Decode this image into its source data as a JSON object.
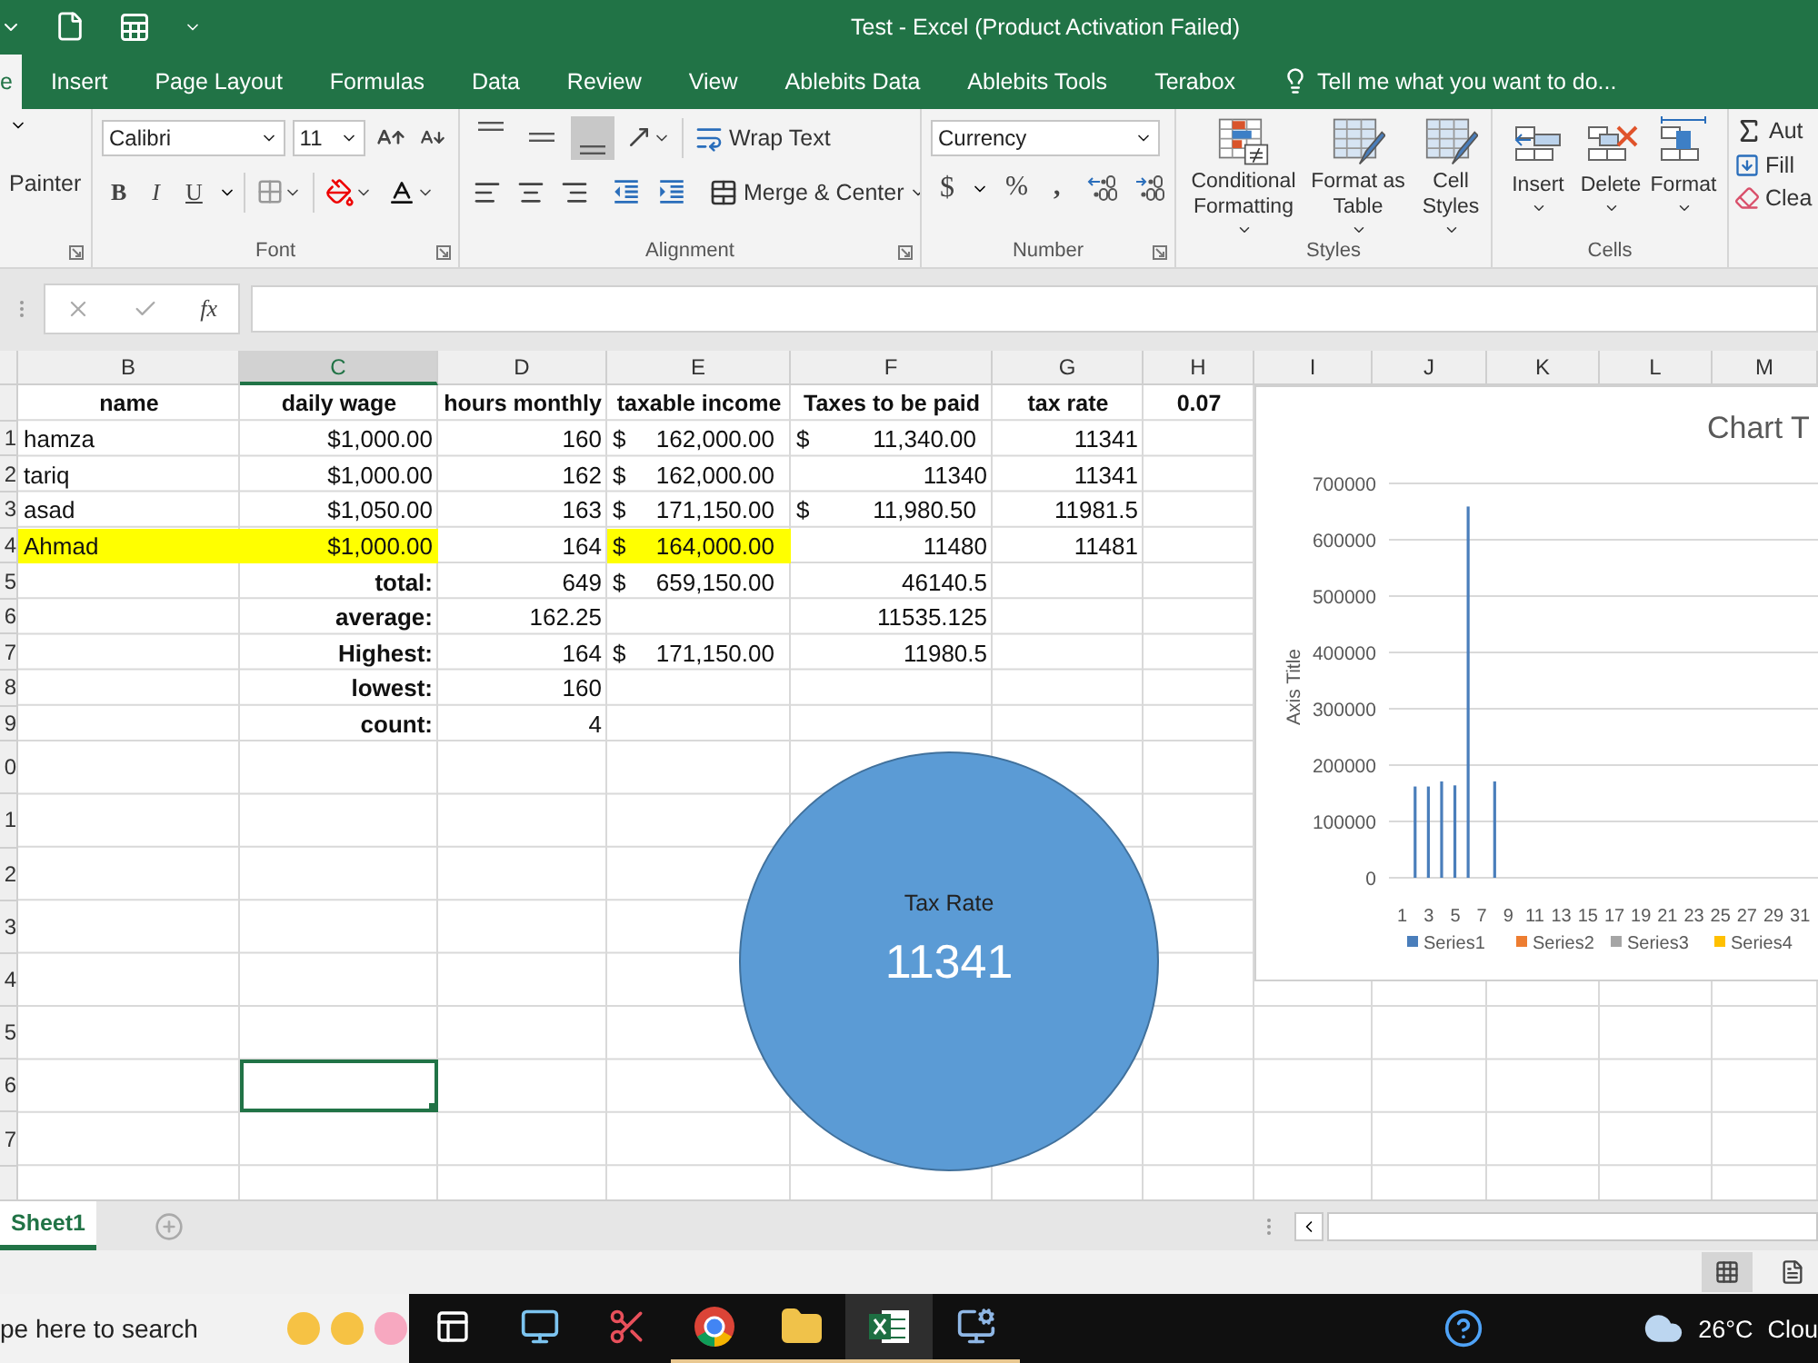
{
  "title_bar": {
    "title": "Test - Excel (Product Activation Failed)"
  },
  "tabs": [
    {
      "label": "e",
      "selected": true
    },
    {
      "label": "Insert",
      "selected": false
    },
    {
      "label": "Page Layout",
      "selected": false
    },
    {
      "label": "Formulas",
      "selected": false
    },
    {
      "label": "Data",
      "selected": false
    },
    {
      "label": "Review",
      "selected": false
    },
    {
      "label": "View",
      "selected": false
    },
    {
      "label": "Ablebits Data",
      "selected": false
    },
    {
      "label": "Ablebits Tools",
      "selected": false
    },
    {
      "label": "Terabox",
      "selected": false
    }
  ],
  "tell_me": {
    "placeholder": "Tell me what you want to do..."
  },
  "ribbon": {
    "clipboard": {
      "format_painter": "Painter"
    },
    "font": {
      "name": "Calibri",
      "size": "11",
      "bold": "B",
      "italic": "I",
      "underline": "U",
      "label": "Font"
    },
    "alignment": {
      "vertical": [
        {
          "selected": false
        },
        {
          "selected": false
        },
        {
          "selected": true
        }
      ],
      "wrap_text": "Wrap Text",
      "merge": "Merge & Center",
      "label": "Alignment"
    },
    "number": {
      "format": "Currency",
      "currency": "$",
      "percent": "%",
      "comma": ",",
      "label": "Number"
    },
    "styles": {
      "buttons": [
        "Conditional Formatting",
        "Format as Table",
        "Cell Styles"
      ],
      "label": "Styles"
    },
    "cells": {
      "buttons": [
        "Insert",
        "Delete",
        "Format"
      ],
      "label": "Cells"
    },
    "editing": {
      "autosum": "Aut",
      "fill": "Fill",
      "clear": "Clea"
    }
  },
  "formula_bar": {
    "function_label": "fx"
  },
  "sheet": {
    "columns": [
      {
        "label": "B",
        "selected": false
      },
      {
        "label": "C",
        "selected": true
      },
      {
        "label": "D",
        "selected": false
      },
      {
        "label": "E",
        "selected": false
      },
      {
        "label": "F",
        "selected": false
      },
      {
        "label": "G",
        "selected": false
      },
      {
        "label": "H",
        "selected": false
      },
      {
        "label": "I",
        "selected": false
      },
      {
        "label": "J",
        "selected": false
      },
      {
        "label": "K",
        "selected": false
      },
      {
        "label": "L",
        "selected": false
      },
      {
        "label": "M",
        "selected": false
      }
    ],
    "rows": [
      {
        "cells": [
          {
            "kind": "header",
            "text": "name",
            "highlighted": false,
            "selected": false
          },
          {
            "kind": "header",
            "text": "daily wage",
            "highlighted": false,
            "selected": false
          },
          {
            "kind": "header",
            "text": "hours monthly",
            "highlighted": false,
            "selected": false
          },
          {
            "kind": "header",
            "text": "taxable income",
            "highlighted": false,
            "selected": false
          },
          {
            "kind": "header",
            "text": "Taxes to be paid",
            "highlighted": false,
            "selected": false
          },
          {
            "kind": "header",
            "text": "tax rate",
            "highlighted": false,
            "selected": false
          },
          {
            "kind": "header",
            "text": "0.07",
            "highlighted": false,
            "selected": false
          }
        ]
      },
      {
        "number": "1",
        "cells": [
          {
            "kind": "text",
            "text": "hamza",
            "highlighted": false,
            "selected": false
          },
          {
            "kind": "number",
            "text": "$1,000.00",
            "highlighted": false,
            "selected": false
          },
          {
            "kind": "number",
            "text": "160",
            "highlighted": false,
            "selected": false
          },
          {
            "kind": "accounting",
            "symbol": "$",
            "text": "162,000.00",
            "highlighted": false,
            "selected": false
          },
          {
            "kind": "accounting",
            "symbol": "$",
            "text": "11,340.00",
            "highlighted": false,
            "selected": false
          },
          {
            "kind": "number",
            "text": "11341",
            "highlighted": false,
            "selected": false
          }
        ]
      },
      {
        "number": "2",
        "cells": [
          {
            "kind": "text",
            "text": "tariq",
            "highlighted": false,
            "selected": false
          },
          {
            "kind": "number",
            "text": "$1,000.00",
            "highlighted": false,
            "selected": false
          },
          {
            "kind": "number",
            "text": "162",
            "highlighted": false,
            "selected": false
          },
          {
            "kind": "accounting",
            "symbol": "$",
            "text": "162,000.00",
            "highlighted": false,
            "selected": false
          },
          {
            "kind": "number",
            "text": "11340",
            "highlighted": false,
            "selected": false
          },
          {
            "kind": "number",
            "text": "11341",
            "highlighted": false,
            "selected": false
          }
        ]
      },
      {
        "number": "3",
        "cells": [
          {
            "kind": "text",
            "text": "asad",
            "highlighted": false,
            "selected": false
          },
          {
            "kind": "number",
            "text": "$1,050.00",
            "highlighted": false,
            "selected": false
          },
          {
            "kind": "number",
            "text": "163",
            "highlighted": false,
            "selected": false
          },
          {
            "kind": "accounting",
            "symbol": "$",
            "text": "171,150.00",
            "highlighted": false,
            "selected": false
          },
          {
            "kind": "accounting",
            "symbol": "$",
            "text": "11,980.50",
            "highlighted": false,
            "selected": false
          },
          {
            "kind": "number",
            "text": "11981.5",
            "highlighted": false,
            "selected": false
          }
        ]
      },
      {
        "number": "4",
        "cells": [
          {
            "kind": "text",
            "text": "Ahmad",
            "highlighted": true,
            "selected": false
          },
          {
            "kind": "number",
            "text": "$1,000.00",
            "highlighted": true,
            "selected": false
          },
          {
            "kind": "number",
            "text": "164",
            "highlighted": false,
            "selected": false
          },
          {
            "kind": "accounting",
            "symbol": "$",
            "text": "164,000.00",
            "highlighted": true,
            "selected": false
          },
          {
            "kind": "number",
            "text": "11480",
            "highlighted": false,
            "selected": false
          },
          {
            "kind": "number",
            "text": "11481",
            "highlighted": false,
            "selected": false
          }
        ]
      },
      {
        "number": "5",
        "cells": [
          {
            "kind": "empty",
            "selected": false
          },
          {
            "kind": "label",
            "text": "total:",
            "highlighted": false,
            "selected": false
          },
          {
            "kind": "number",
            "text": "649",
            "highlighted": false,
            "selected": false
          },
          {
            "kind": "accounting",
            "symbol": "$",
            "text": "659,150.00",
            "highlighted": false,
            "selected": false
          },
          {
            "kind": "number",
            "text": "46140.5",
            "highlighted": false,
            "selected": false
          }
        ]
      },
      {
        "number": "6",
        "cells": [
          {
            "kind": "empty",
            "selected": false
          },
          {
            "kind": "label",
            "text": "average:",
            "highlighted": false,
            "selected": false
          },
          {
            "kind": "number",
            "text": "162.25",
            "highlighted": false,
            "selected": false
          },
          {
            "kind": "empty",
            "selected": false
          },
          {
            "kind": "number",
            "text": "11535.125",
            "highlighted": false,
            "selected": false
          }
        ]
      },
      {
        "number": "7",
        "cells": [
          {
            "kind": "empty",
            "selected": false
          },
          {
            "kind": "label",
            "text": "Highest:",
            "highlighted": false,
            "selected": false
          },
          {
            "kind": "number",
            "text": "164",
            "highlighted": false,
            "selected": false
          },
          {
            "kind": "accounting",
            "symbol": "$",
            "text": "171,150.00",
            "highlighted": false,
            "selected": false
          },
          {
            "kind": "number",
            "text": "11980.5",
            "highlighted": false,
            "selected": false
          }
        ]
      },
      {
        "number": "8",
        "cells": [
          {
            "kind": "empty",
            "selected": false
          },
          {
            "kind": "label",
            "text": "lowest:",
            "highlighted": false,
            "selected": false
          },
          {
            "kind": "number",
            "text": "160",
            "highlighted": false,
            "selected": false
          }
        ]
      },
      {
        "number": "9",
        "cells": [
          {
            "kind": "empty",
            "selected": false
          },
          {
            "kind": "label",
            "text": "count:",
            "highlighted": false,
            "selected": false
          },
          {
            "kind": "number",
            "text": "4",
            "highlighted": false,
            "selected": false
          }
        ]
      },
      {
        "number": "0"
      },
      {
        "number": "1"
      },
      {
        "number": "2"
      },
      {
        "number": "3"
      },
      {
        "number": "4"
      },
      {
        "number": "5"
      },
      {
        "number": "6",
        "cells": [
          {
            "kind": "empty",
            "selected": false
          },
          {
            "kind": "empty",
            "selected": true
          }
        ]
      },
      {
        "number": "7"
      }
    ]
  },
  "column_chart": {
    "chart_data": {
      "type": "bar",
      "title": "Chart T",
      "ylabel": "Axis Title",
      "grid": true,
      "x": [
        2,
        3,
        4,
        5,
        6,
        8
      ],
      "xlim": [
        0,
        34
      ],
      "xticks": [
        1,
        3,
        5,
        7,
        9,
        11,
        13,
        15,
        17,
        19,
        21,
        23,
        25,
        27,
        29,
        31
      ],
      "ylim": [
        0,
        700000
      ],
      "yticks": [
        0,
        100000,
        200000,
        300000,
        400000,
        500000,
        600000,
        700000
      ],
      "series": [
        {
          "name": "Series1",
          "color": "#4a7ebb",
          "values": [
            162000,
            162000,
            171000,
            164000,
            659000,
            171000
          ]
        },
        {
          "name": "Series2",
          "color": "#ed7d31",
          "values": [
            null,
            null,
            null,
            null,
            null,
            null
          ]
        },
        {
          "name": "Series3",
          "color": "#a5a5a5",
          "values": [
            null,
            null,
            null,
            null,
            null,
            null
          ]
        },
        {
          "name": "Series4",
          "color": "#ffc000",
          "values": [
            null,
            null,
            null,
            null,
            null,
            null
          ]
        }
      ]
    }
  },
  "pie_chart": {
    "chart_data": {
      "type": "pie",
      "title": "Tax Rate",
      "series": [
        {
          "color": "#5b9bd5",
          "values": [
            11341
          ]
        }
      ],
      "data_labels": true
    }
  },
  "sheet_tabs": [
    {
      "label": "Sheet1",
      "selected": true
    }
  ],
  "status_bar": {
    "views": [
      {
        "selected": true
      },
      {
        "selected": false
      }
    ]
  },
  "taskbar": {
    "search": {
      "placeholder": "pe here to search"
    },
    "apps": [
      {
        "kind": "task_view",
        "running": false,
        "selected": false
      },
      {
        "kind": "computer",
        "running": false,
        "selected": false
      },
      {
        "kind": "snipping",
        "running": false,
        "selected": false
      },
      {
        "kind": "browser",
        "running": true,
        "selected": false
      },
      {
        "kind": "folder",
        "running": true,
        "selected": false
      },
      {
        "kind": "spreadsheet",
        "running": true,
        "selected": true
      },
      {
        "kind": "network",
        "running": true,
        "selected": false
      }
    ],
    "weather": {
      "temperature": "26°C",
      "condition": "Clou"
    }
  }
}
